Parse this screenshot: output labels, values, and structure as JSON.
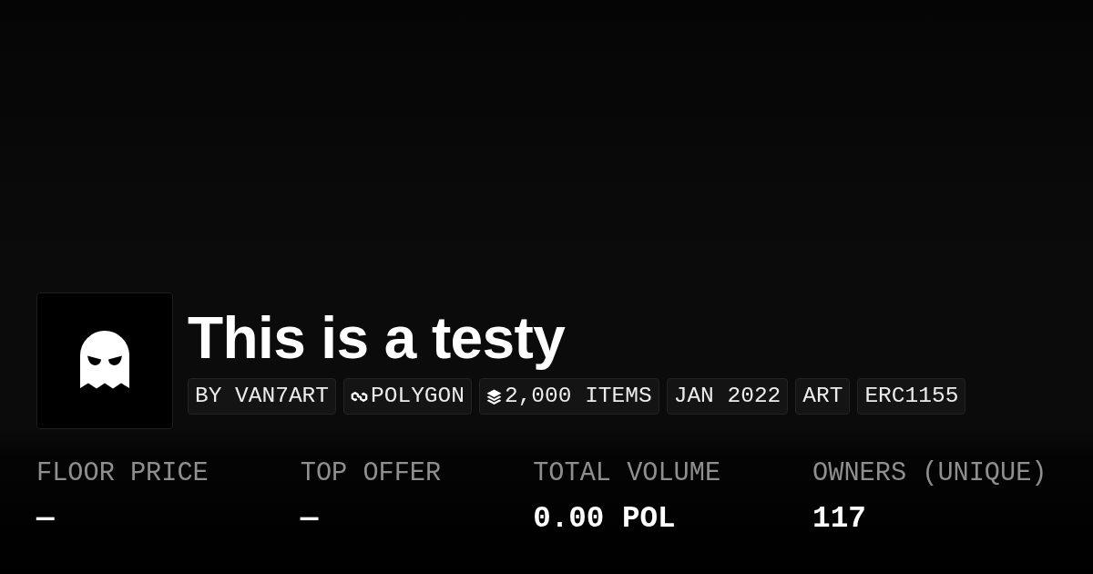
{
  "collection": {
    "title": "This is a testy",
    "tags": [
      {
        "kind": "plain",
        "label": "BY VAN7ART"
      },
      {
        "kind": "chain",
        "label": "POLYGON"
      },
      {
        "kind": "count",
        "label": "2,000 ITEMS"
      },
      {
        "kind": "plain",
        "label": "JAN 2022"
      },
      {
        "kind": "plain",
        "label": "ART"
      },
      {
        "kind": "plain",
        "label": "ERC1155"
      }
    ]
  },
  "stats": [
    {
      "label": "FLOOR PRICE",
      "value": "—"
    },
    {
      "label": "TOP OFFER",
      "value": "—"
    },
    {
      "label": "TOTAL VOLUME",
      "value": "0.00 POL"
    },
    {
      "label": "OWNERS (UNIQUE)",
      "value": "117"
    }
  ]
}
